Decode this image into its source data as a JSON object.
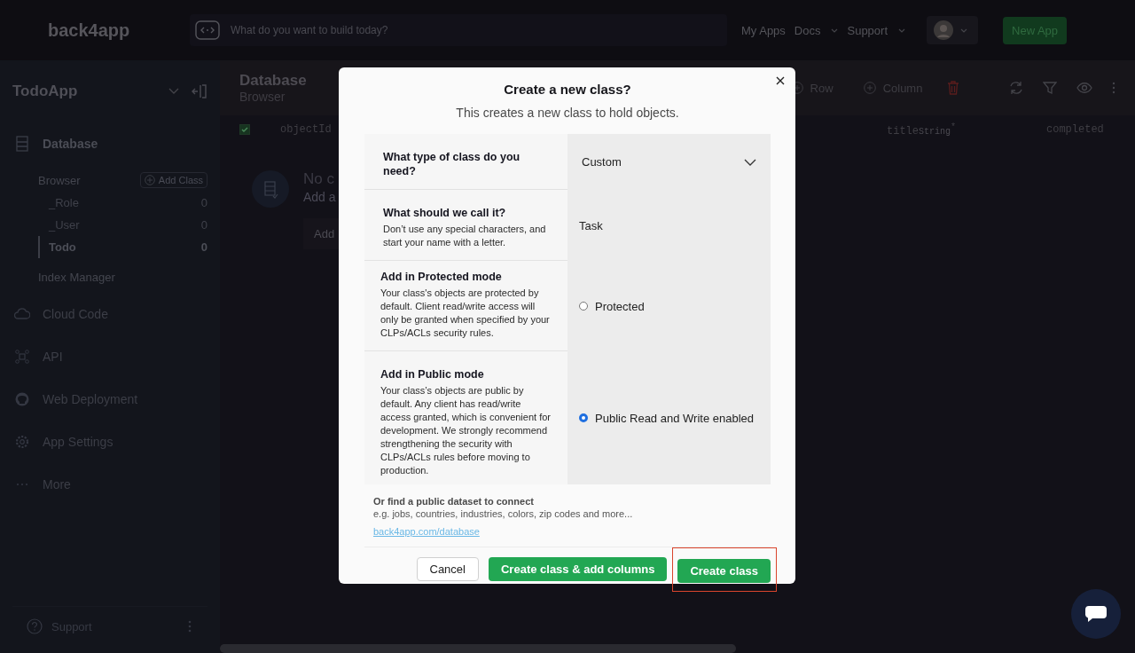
{
  "topbar": {
    "logo": "back4app",
    "search": {
      "placeholder": "What do you want to build today?"
    },
    "nav": [
      {
        "label": "My Apps",
        "dropdown": false
      },
      {
        "label": "Docs",
        "dropdown": true
      },
      {
        "label": "Support",
        "dropdown": true
      }
    ],
    "new_app_button": "New App"
  },
  "sidebar": {
    "app_name": "TodoApp",
    "database": {
      "label": "Database",
      "browser_label": "Browser",
      "add_class": "Add Class",
      "classes": [
        {
          "name": "_Role",
          "count": "0",
          "selected": false
        },
        {
          "name": "_User",
          "count": "0",
          "selected": false
        },
        {
          "name": "Todo",
          "count": "0",
          "selected": true
        }
      ],
      "index_manager": "Index Manager"
    },
    "items": [
      {
        "label": "Cloud Code"
      },
      {
        "label": "API"
      },
      {
        "label": "Web Deployment"
      },
      {
        "label": "App Settings"
      },
      {
        "label": "More"
      }
    ],
    "support": "Support"
  },
  "main": {
    "title": "Database",
    "subtitle": "Browser",
    "toolbar": [
      "Row",
      "Column"
    ],
    "select_all": {
      "checked": true
    },
    "columns": [
      {
        "name": "objectId"
      },
      {
        "name": "title",
        "type": "String",
        "required_mark": "*"
      },
      {
        "name": "completed"
      }
    ],
    "empty": {
      "title": "No c",
      "text": "Add a",
      "button": "Add"
    }
  },
  "dialog": {
    "title": "Create a new class?",
    "subtitle": "This creates a new class to hold objects.",
    "rows": [
      {
        "kind": "select",
        "label": "What type of class do you need?",
        "value": "Custom"
      },
      {
        "kind": "input",
        "label": "What should we call it?",
        "help": "Don’t use any special characters, and start your name with a letter.",
        "value": "Task"
      },
      {
        "kind": "radio",
        "label": "Add in Protected mode",
        "help": "Your class's objects are protected by default. Client read/write access will only be granted when specified by your CLPs/ACLs security rules.",
        "option": "Protected",
        "selected": false
      },
      {
        "kind": "radio",
        "label": "Add in Public mode",
        "help": "Your class’s objects are public by default. Any client has read/write access granted, which is convenient for development. We strongly recommend strengthening the security with CLPs/ACLs rules before moving to production.",
        "option": "Public Read and Write enabled",
        "selected": true
      }
    ],
    "dataset": {
      "title": "Or find a public dataset to connect",
      "text": "e.g. jobs, countries, industries, colors, zip codes and more...",
      "link": "back4app.com/database"
    },
    "buttons": [
      {
        "label": "Cancel",
        "kind": "secondary",
        "highlighted": false
      },
      {
        "label": "Create class & add columns",
        "kind": "primary",
        "highlighted": false
      },
      {
        "label": "Create class",
        "kind": "primary",
        "highlighted": true
      }
    ]
  }
}
